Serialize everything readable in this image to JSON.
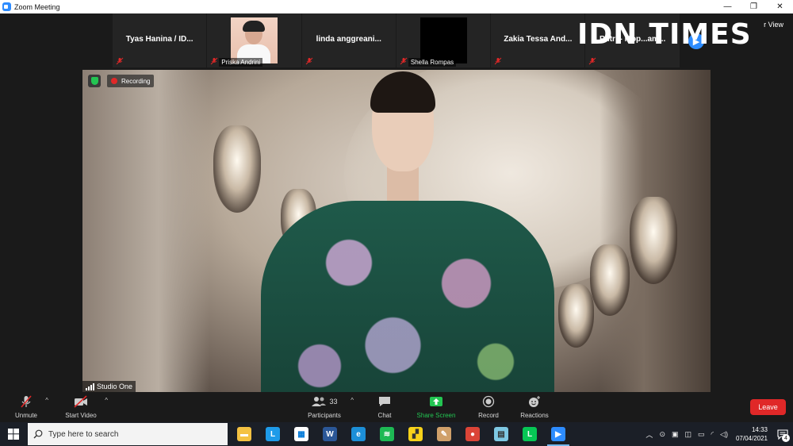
{
  "window": {
    "title": "Zoom Meeting",
    "controls": [
      "—",
      "❐",
      "✕"
    ]
  },
  "gallery": {
    "tiles": [
      {
        "name": "Tyas Hanina / ID...",
        "label": ""
      },
      {
        "name": "",
        "label": "Priska Andrini"
      },
      {
        "name": "linda  anggreani...",
        "label": ""
      },
      {
        "name": "",
        "label": "Shella Rompas"
      },
      {
        "name": "Zakia Tessa And...",
        "label": ""
      },
      {
        "name": "Putri - Mop...am...",
        "label": ""
      }
    ],
    "speaker_view": "r View"
  },
  "watermark": {
    "left": "IDN",
    "right": "TIMES"
  },
  "video": {
    "recording_label": "Recording",
    "name_tag": "Studio One"
  },
  "controls": {
    "unmute": "Unmute",
    "start_video": "Start Video",
    "participants": "Participants",
    "participants_count": "33",
    "chat": "Chat",
    "share_screen": "Share Screen",
    "record": "Record",
    "reactions": "Reactions",
    "leave": "Leave"
  },
  "taskbar": {
    "search_placeholder": "Type here to search",
    "apps": [
      {
        "icon": "file-explorer-icon",
        "color": "#f4c242",
        "glyph": "▬"
      },
      {
        "icon": "l-app-icon",
        "color": "#1e9be9",
        "glyph": "L"
      },
      {
        "icon": "microsoft-store-icon",
        "color": "#ffffff",
        "glyph": "▦"
      },
      {
        "icon": "word-icon",
        "color": "#2b5797",
        "glyph": "W"
      },
      {
        "icon": "edge-icon",
        "color": "#1c8fd8",
        "glyph": "e"
      },
      {
        "icon": "spotify-icon",
        "color": "#1db954",
        "glyph": "≋"
      },
      {
        "icon": "sticky-notes-icon",
        "color": "#f7d21a",
        "glyph": "▞"
      },
      {
        "icon": "paint-icon",
        "color": "#d0a06a",
        "glyph": "✎"
      },
      {
        "icon": "chrome-icon",
        "color": "#db4437",
        "glyph": "●"
      },
      {
        "icon": "notepad-icon",
        "color": "#7ec8e3",
        "glyph": "▤"
      },
      {
        "icon": "line-icon",
        "color": "#06c755",
        "glyph": "L"
      },
      {
        "icon": "zoom-icon",
        "color": "#2d8cff",
        "glyph": "▶"
      }
    ],
    "active_app": 11,
    "time": "14:33",
    "date": "07/04/2021",
    "notification_count": "4"
  },
  "colors": {
    "accent": "#2d8cff",
    "leave": "#e02828",
    "share": "#23c552",
    "recording": "#e02828"
  }
}
